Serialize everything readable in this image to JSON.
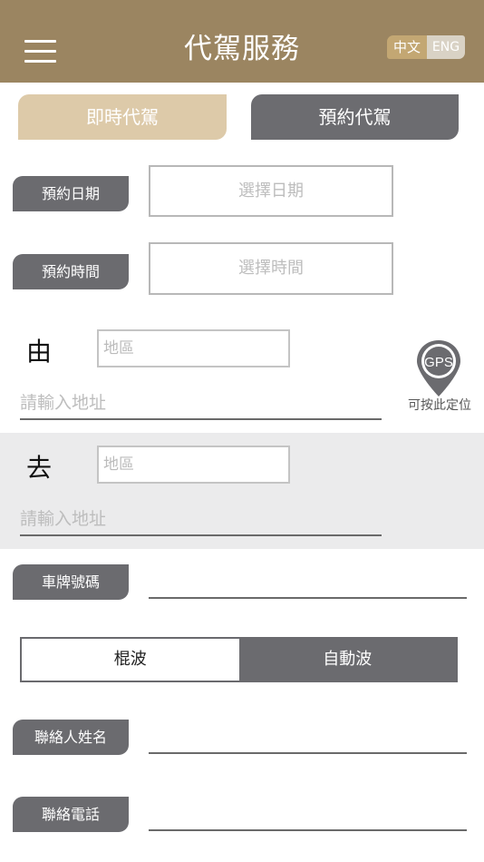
{
  "header": {
    "title": "代駕服務",
    "lang_zh": "中文",
    "lang_en": "ENG"
  },
  "tabs": {
    "instant": "即時代駕",
    "reserve": "預約代駕",
    "active": "instant"
  },
  "reservation": {
    "date_label": "預約日期",
    "date_placeholder": "選擇日期",
    "time_label": "預約時間",
    "time_placeholder": "選擇時間"
  },
  "from": {
    "label": "由",
    "region_placeholder": "地區",
    "address_placeholder": "請輸入地址",
    "gps_icon_text": "GPS",
    "gps_caption": "可按此定位"
  },
  "to": {
    "label": "去",
    "region_placeholder": "地區",
    "address_placeholder": "請輸入地址"
  },
  "plate": {
    "label": "車牌號碼",
    "value": ""
  },
  "gear": {
    "manual": "棍波",
    "auto": "自動波",
    "selected": "auto"
  },
  "contact": {
    "name_label": "聯絡人姓名",
    "name_value": "",
    "phone_label": "聯絡電話",
    "phone_value": ""
  },
  "colors": {
    "header_bg": "#9b8561",
    "accent_gold": "#c3a773",
    "tab_active": "#ddcaa9",
    "dark_grey": "#6b6b6f"
  }
}
